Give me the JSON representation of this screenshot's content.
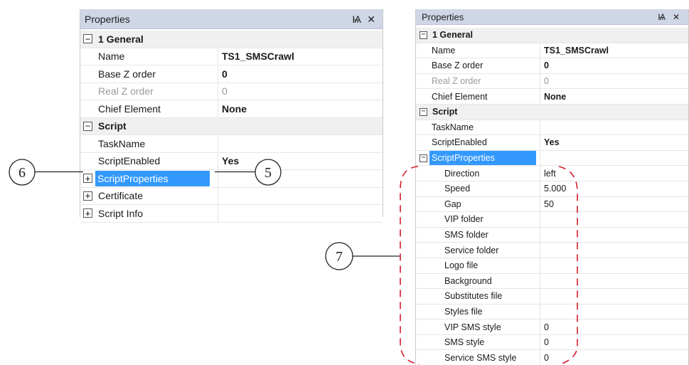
{
  "left_panel": {
    "title": "Properties",
    "pin_glyph": "Ѩ",
    "close_glyph": "✕",
    "rows": [
      {
        "kind": "cat",
        "toggle": "−",
        "label": "1 General"
      },
      {
        "label": "Name",
        "value": "TS1_SMSCrawl",
        "bold": true
      },
      {
        "label": "Base Z order",
        "value": "0",
        "bold": true
      },
      {
        "label": "Real Z order",
        "value": "0",
        "disabled": true
      },
      {
        "label": "Chief Element",
        "value": "None",
        "bold": true
      },
      {
        "kind": "cat",
        "toggle": "−",
        "label": "Script"
      },
      {
        "label": "TaskName",
        "value": ""
      },
      {
        "label": "ScriptEnabled",
        "value": "Yes",
        "bold": true
      },
      {
        "kind": "top",
        "toggle": "+",
        "label": "ScriptProperties",
        "selected": true
      },
      {
        "kind": "top",
        "toggle": "+",
        "label": "Certificate"
      },
      {
        "kind": "top",
        "toggle": "+",
        "label": "Script Info"
      }
    ]
  },
  "right_panel": {
    "title": "Properties",
    "pin_glyph": "Ѩ",
    "close_glyph": "✕",
    "rows": [
      {
        "kind": "cat",
        "toggle": "−",
        "label": "1 General"
      },
      {
        "label": "Name",
        "value": "TS1_SMSCrawl",
        "bold": true
      },
      {
        "label": "Base Z order",
        "value": "0",
        "bold": true
      },
      {
        "label": "Real Z order",
        "value": "0",
        "disabled": true
      },
      {
        "label": "Chief Element",
        "value": "None",
        "bold": true
      },
      {
        "kind": "cat",
        "toggle": "−",
        "label": "Script"
      },
      {
        "label": "TaskName",
        "value": ""
      },
      {
        "label": "ScriptEnabled",
        "value": "Yes",
        "bold": true
      },
      {
        "kind": "top",
        "toggle": "−",
        "label": "ScriptProperties",
        "selected": true
      },
      {
        "kind": "sub",
        "label": "Direction",
        "value": "left"
      },
      {
        "kind": "sub",
        "label": "Speed",
        "value": "5.000"
      },
      {
        "kind": "sub",
        "label": "Gap",
        "value": "50"
      },
      {
        "kind": "sub",
        "label": "VIP folder",
        "value": ""
      },
      {
        "kind": "sub",
        "label": "SMS folder",
        "value": ""
      },
      {
        "kind": "sub",
        "label": "Service folder",
        "value": ""
      },
      {
        "kind": "sub",
        "label": "Logo file",
        "value": ""
      },
      {
        "kind": "sub",
        "label": "Background",
        "value": ""
      },
      {
        "kind": "sub",
        "label": "Substitutes file",
        "value": ""
      },
      {
        "kind": "sub",
        "label": "Styles file",
        "value": ""
      },
      {
        "kind": "sub",
        "label": "VIP SMS style",
        "value": "0"
      },
      {
        "kind": "sub",
        "label": "SMS style",
        "value": "0"
      },
      {
        "kind": "sub",
        "label": "Service SMS style",
        "value": "0"
      }
    ]
  },
  "callouts": {
    "six": "6",
    "five": "5",
    "seven": "7"
  },
  "colors": {
    "header": "#cfd6e5",
    "selection": "#3399ff",
    "callout_dash": "#d11a2a"
  }
}
